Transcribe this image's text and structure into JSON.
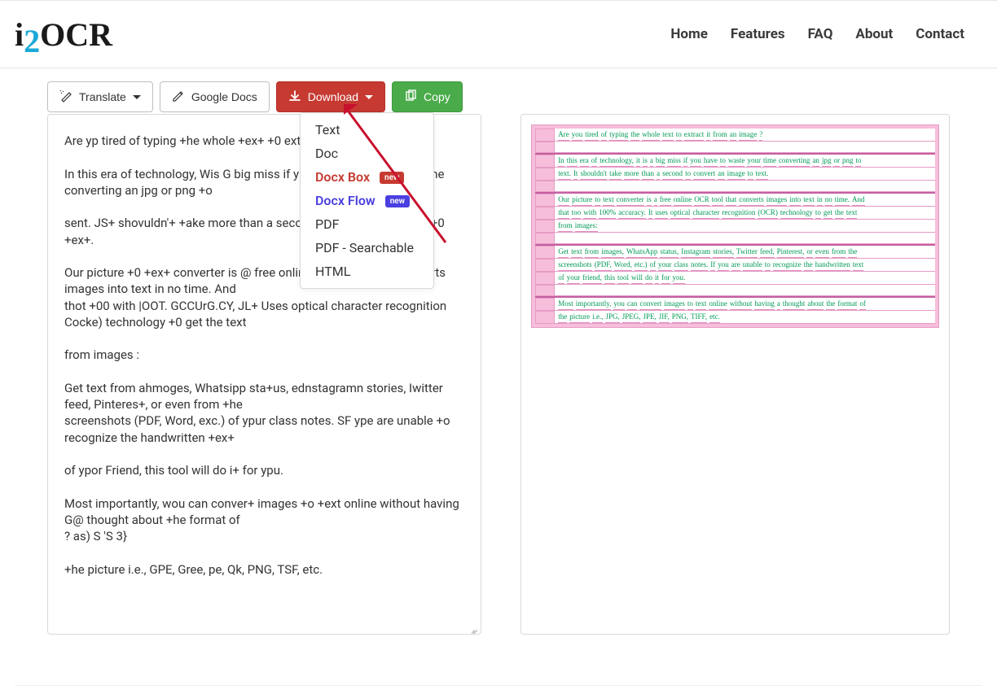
{
  "header": {
    "logo_part1": "i",
    "logo_part2": "2",
    "logo_part3": "OCR",
    "nav": {
      "home": "Home",
      "features": "Features",
      "faq": "FAQ",
      "about": "About",
      "contact": "Contact"
    }
  },
  "toolbar": {
    "translate_label": "Translate",
    "google_docs_label": "Google Docs",
    "download_label": "Download",
    "copy_label": "Copy"
  },
  "download_menu": {
    "text": "Text",
    "doc": "Doc",
    "docx_box": "Docx Box",
    "docx_flow": "Docx Flow",
    "pdf": "PDF",
    "pdf_search": "PDF - Searchable",
    "html": "HTML",
    "badge_new": "new"
  },
  "ocr_text": "Are yp tired of typing +he whole +ex+ +0 extract i+ from an image?\n\nIn this era of technology, Wis G big miss if ype have +0 Waste ype time converting an jpg or png +o\n\nsent. JS+ shovuldn'+ +ake more than a second +0 conver+ an wage +0 +ex+.\n\nOur picture +0 +ex+ converter is @ free online OCR +o0l +ha+ converts images into text in no time. And\nthot +00 with |OOT. GCCUrG.CY, JL+ Uses optical character recognition Cocke) technology +0 get the text\n\nfrom images :\n\nGet text from ahmoges, Whatsipp sta+us, ednstagramn stories, Iwitter feed, Pinteres+, or even from +he\nscreenshots (PDF, Word, exc.) of ypur class notes. SF ype are unable +o recognize the handwritten +ex+\n\nof ypor Friend, this tool will do i+ for ypu.\n\nMost importantly, wou can conver+ images +o +ext online without having G@ thought about +he format of\n? as) S 'S 3}\n\n+he picture i.e., GPE, Gree, pe, Qk, PNG, TSF, etc.",
  "preview": {
    "lines": [
      [
        "Are",
        "you",
        "tired",
        "of",
        "typing",
        "the",
        "whole",
        "text",
        "to",
        "extract",
        "it",
        "from",
        "an",
        "image",
        "?"
      ],
      [],
      [
        "In",
        "this",
        "era",
        "of",
        "technology,",
        "it",
        "is",
        "a",
        "big",
        "miss",
        "if",
        "you",
        "have",
        "to",
        "waste",
        "your",
        "time",
        "converting",
        "an",
        "jpg",
        "or",
        "png",
        "to"
      ],
      [
        "text.",
        "It",
        "shouldn't",
        "take",
        "more",
        "than",
        "a",
        "second",
        "to",
        "convert",
        "an",
        "image",
        "to",
        "text."
      ],
      [],
      [
        "Our",
        "picture",
        "to",
        "text",
        "converter",
        "is",
        "a",
        "free",
        "online",
        "OCR",
        "tool",
        "that",
        "converts",
        "images",
        "into",
        "text",
        "in",
        "no",
        "time.",
        "And"
      ],
      [
        "that",
        "too",
        "with",
        "100%",
        "accuracy.",
        "It",
        "uses",
        "optical",
        "character",
        "recognition",
        "(OCR)",
        "technology",
        "to",
        "get",
        "the",
        "text"
      ],
      [
        "from",
        "images:"
      ],
      [],
      [
        "Get",
        "text",
        "from",
        "images,",
        "WhatsApp",
        "status,",
        "Instagram",
        "stories,",
        "Twitter",
        "feed,",
        "Pinterest,",
        "or",
        "even",
        "from",
        "the"
      ],
      [
        "screenshots",
        "(PDF,",
        "Word,",
        "etc.)",
        "of",
        "your",
        "class",
        "notes.",
        "If",
        "you",
        "are",
        "unable",
        "to",
        "recognize",
        "the",
        "handwritten",
        "text"
      ],
      [
        "of",
        "your",
        "friend,",
        "this",
        "tool",
        "will",
        "do",
        "it",
        "for",
        "you."
      ],
      [],
      [
        "Most",
        "importantly,",
        "you",
        "can",
        "convert",
        "images",
        "to",
        "text",
        "online",
        "without",
        "having",
        "a",
        "thought",
        "about",
        "the",
        "format",
        "of"
      ],
      [
        "the",
        "picture",
        "i.e.,",
        "JPG,",
        "JPEG,",
        "JPE,",
        "JIF,",
        "PNG,",
        "TIFF,",
        "etc."
      ]
    ]
  }
}
